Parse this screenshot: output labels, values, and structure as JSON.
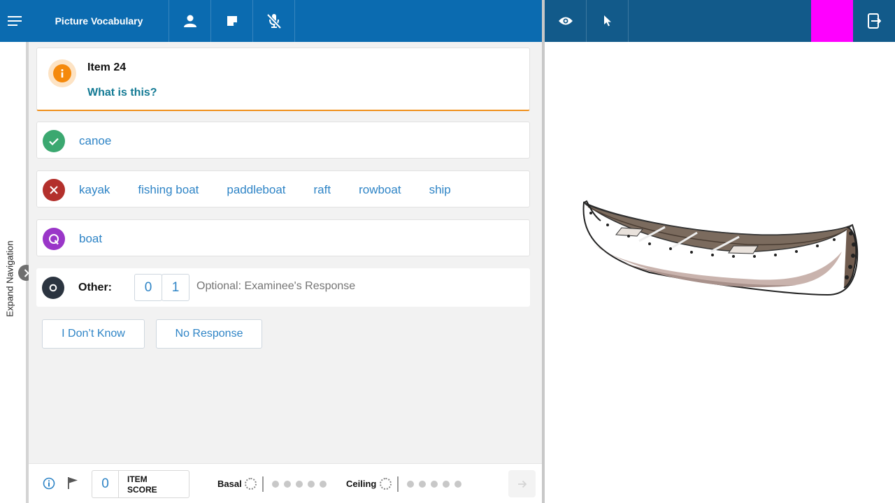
{
  "app": {
    "title": "Picture Vocabulary"
  },
  "item": {
    "title": "Item 24",
    "question": "What is this?"
  },
  "correct": {
    "words": [
      "canoe"
    ]
  },
  "incorrect": {
    "words": [
      "kayak",
      "fishing boat",
      "paddleboat",
      "raft",
      "rowboat",
      "ship"
    ]
  },
  "query": {
    "words": [
      "boat"
    ]
  },
  "other": {
    "label": "Other:",
    "score0": "0",
    "score1": "1",
    "placeholder": "Optional: Examinee's Response"
  },
  "buttons": {
    "dont_know": "I Don’t Know",
    "no_response": "No Response"
  },
  "sidebar": {
    "expand_label": "Expand Navigation"
  },
  "bottom": {
    "item_score": "0",
    "item_score_label": "ITEM SCORE",
    "basal_label": "Basal",
    "ceiling_label": "Ceiling"
  },
  "colors": {
    "topbar_left": "#0b6bb0",
    "topbar_right": "#125a8a",
    "correct": "#3ba870",
    "incorrect": "#b3302c",
    "query": "#9a36c8",
    "other": "#2b3440",
    "accent": "#f5890b",
    "link": "#2e84c6",
    "question": "#137a94"
  },
  "icons": [
    "menu-icon",
    "person-icon",
    "note-icon",
    "mic-off-icon",
    "eye-icon",
    "pointer-icon",
    "exit-screen-icon",
    "info-icon",
    "check-icon",
    "x-icon",
    "q-icon",
    "circle-icon",
    "chevron-right-icon",
    "flag-icon",
    "arrow-right-icon"
  ]
}
